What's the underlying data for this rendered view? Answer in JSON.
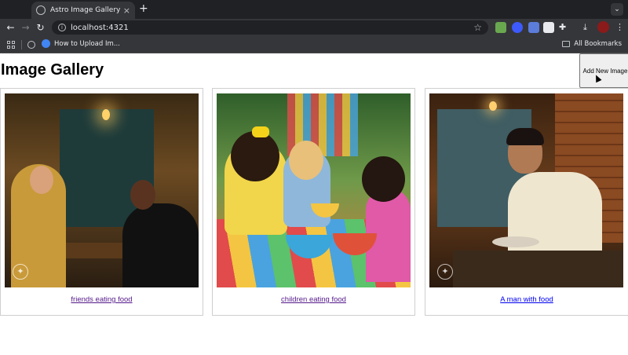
{
  "browser": {
    "tab_title": "Astro Image Gallery",
    "tab_close": "×",
    "new_tab": "+",
    "tab_search": "⌄",
    "url": "localhost:4321",
    "bookmark_item": "How to Upload Im...",
    "all_bookmarks": "All Bookmarks"
  },
  "page": {
    "title": "Image Gallery",
    "add_button": "Add New Image"
  },
  "gallery": [
    {
      "caption": "friends eating food"
    },
    {
      "caption": "children eating food"
    },
    {
      "caption": "A man with food"
    }
  ]
}
